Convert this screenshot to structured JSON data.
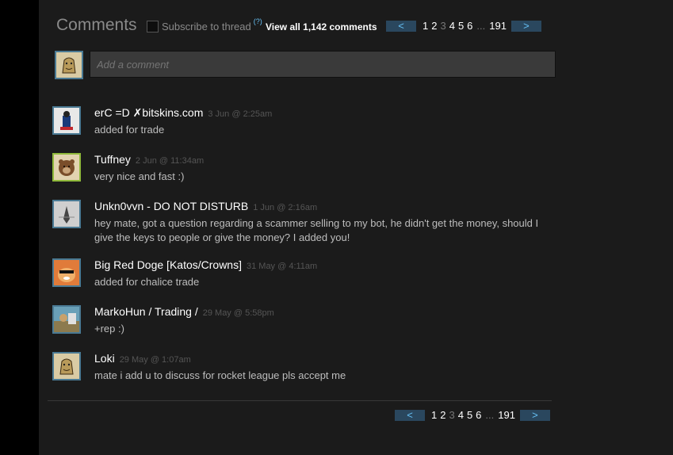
{
  "header": {
    "title": "Comments",
    "subscribe_label": "Subscribe to thread",
    "help": "(?)",
    "view_all": "View all 1,142 comments"
  },
  "pagination": {
    "prev": "<",
    "next": ">",
    "pages": [
      "1",
      "2",
      "3",
      "4",
      "5",
      "6"
    ],
    "current": "3",
    "ellipsis": "...",
    "last": "191"
  },
  "composer": {
    "placeholder": "Add a comment"
  },
  "comments": [
    {
      "author": "erC =D ✗bitskins.com",
      "date": "3 Jun @ 2:25am",
      "text": "added for trade"
    },
    {
      "author": "Tuffney",
      "date": "2 Jun @ 11:34am",
      "text": "very nice and fast :)"
    },
    {
      "author": "Unkn0vvn - DO NOT DISTURB",
      "date": "1 Jun @ 2:16am",
      "text": "hey mate, got a question regarding a scammer selling to my bot, he didn't get the money, should I give the keys to people or give the money? I added you!"
    },
    {
      "author": "Big Red Doge [Katos/Crowns]",
      "date": "31 May @ 4:11am",
      "text": "added for chalice trade"
    },
    {
      "author": "MarkoHun / Trading /",
      "date": "29 May @ 5:58pm",
      "text": "+rep :)"
    },
    {
      "author": "Loki",
      "date": "29 May @ 1:07am",
      "text": "mate i add u to discuss for rocket league pls accept me"
    }
  ],
  "colors": {
    "accent": "#66c0f4",
    "button_bg": "#2a475e",
    "panel_bg": "#1b1b1b"
  }
}
